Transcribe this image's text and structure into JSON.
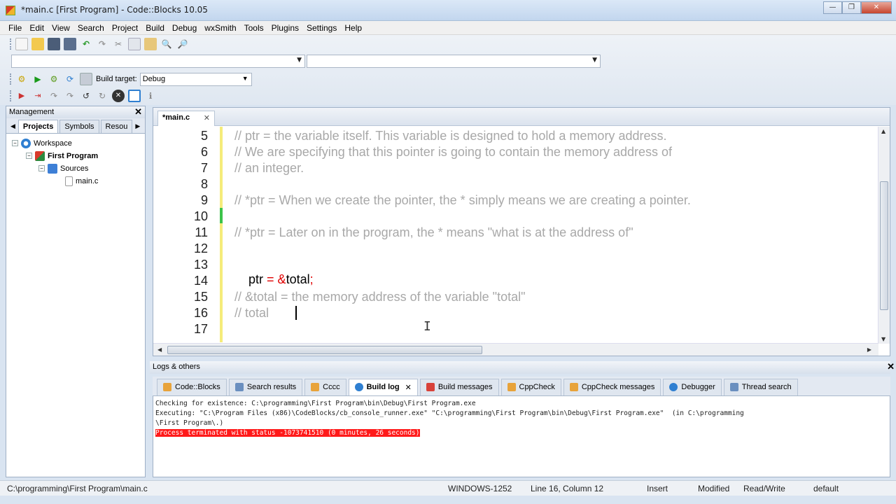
{
  "window": {
    "title": "*main.c [First Program] - Code::Blocks 10.05"
  },
  "menu": [
    "File",
    "Edit",
    "View",
    "Search",
    "Project",
    "Build",
    "Debug",
    "wxSmith",
    "Tools",
    "Plugins",
    "Settings",
    "Help"
  ],
  "toolbar": {
    "build_target_label": "Build target:",
    "build_target_value": "Debug"
  },
  "management": {
    "title": "Management",
    "tabs": [
      "Projects",
      "Symbols",
      "Resou"
    ],
    "tree": {
      "workspace": "Workspace",
      "project": "First Program",
      "folder": "Sources",
      "file": "main.c"
    }
  },
  "editor": {
    "tab_label": "*main.c",
    "lines": [
      {
        "n": "5",
        "text": "// ptr = the variable itself. This variable is designed to hold a memory address."
      },
      {
        "n": "6",
        "text": "// We are specifying that this pointer is going to contain the memory address of"
      },
      {
        "n": "7",
        "text": "// an integer."
      },
      {
        "n": "8",
        "text": ""
      },
      {
        "n": "9",
        "text": "// *ptr = When we create the pointer, the * simply means we are creating a pointer."
      },
      {
        "n": "10",
        "text": ""
      },
      {
        "n": "11",
        "text": "// *ptr = Later on in the program, the * means \"what is at the address of\""
      },
      {
        "n": "12",
        "text": ""
      },
      {
        "n": "13",
        "code": {
          "a": "ptr",
          "b": " = ",
          "c": "&",
          "d": "total",
          "e": ";"
        }
      },
      {
        "n": "14",
        "text": ""
      },
      {
        "n": "15",
        "text": "// &total = the memory address of the variable \"total\""
      },
      {
        "n": "16",
        "text": "// total"
      },
      {
        "n": "17",
        "text": ""
      }
    ]
  },
  "logs": {
    "title": "Logs & others",
    "tabs": [
      {
        "label": "Code::Blocks",
        "color": "#e8a33a"
      },
      {
        "label": "Search results",
        "color": "#6a8fbf"
      },
      {
        "label": "Cccc",
        "color": "#e8a33a"
      },
      {
        "label": "Build log",
        "color": "#2f7fd1",
        "active": true
      },
      {
        "label": "Build messages",
        "color": "#d8423a"
      },
      {
        "label": "CppCheck",
        "color": "#e8a33a"
      },
      {
        "label": "CppCheck messages",
        "color": "#e8a33a"
      },
      {
        "label": "Debugger",
        "color": "#2f7fd1"
      },
      {
        "label": "Thread search",
        "color": "#6a8fbf"
      }
    ],
    "lines": [
      "Checking for existence: C:\\programming\\First Program\\bin\\Debug\\First Program.exe",
      "Executing: \"C:\\Program Files (x86)\\CodeBlocks/cb_console_runner.exe\" \"C:\\programming\\First Program\\bin\\Debug\\First Program.exe\"  (in C:\\programming",
      "\\First Program\\.)"
    ],
    "error_line": "Process terminated with status -1073741510 (0 minutes, 26 seconds)"
  },
  "status": {
    "path": "C:\\programming\\First Program\\main.c",
    "encoding": "WINDOWS-1252",
    "position": "Line 16, Column 12",
    "mode": "Insert",
    "modified": "Modified",
    "access": "Read/Write",
    "lang": "default"
  }
}
